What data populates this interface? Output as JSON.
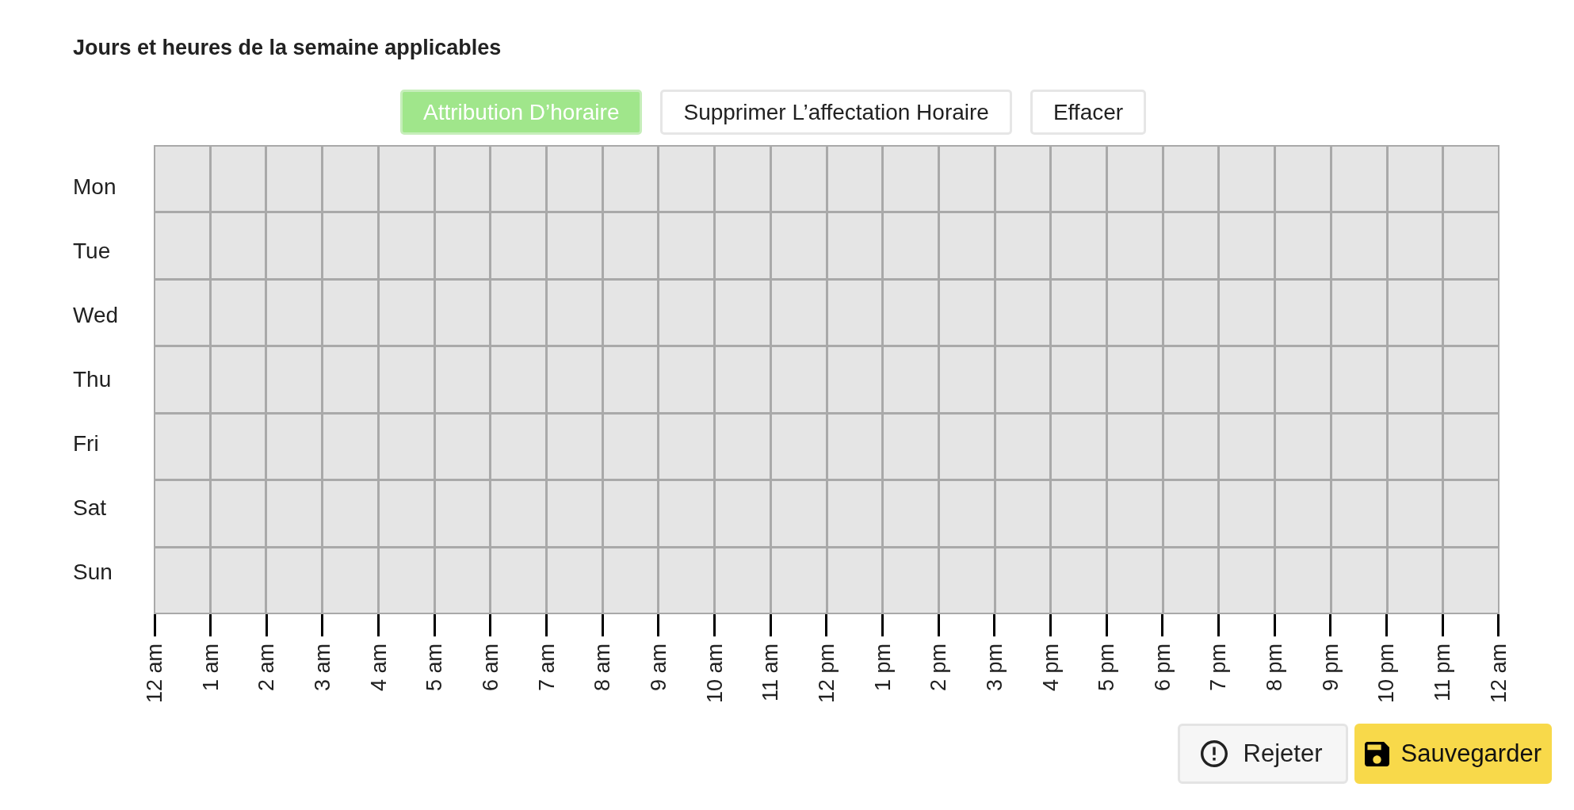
{
  "title": "Jours et heures de la semaine applicables",
  "toolbar": {
    "buttons": [
      {
        "label": "Attribution D’horaire",
        "selected": true
      },
      {
        "label": "Supprimer L’affectation Horaire",
        "selected": false
      },
      {
        "label": "Effacer",
        "selected": false
      }
    ]
  },
  "schedule": {
    "rows": [
      {
        "day": "Mon",
        "cells": [
          {
            "selected": false
          },
          {
            "selected": false
          },
          {
            "selected": false
          },
          {
            "selected": false
          },
          {
            "selected": false
          },
          {
            "selected": false
          },
          {
            "selected": false
          },
          {
            "selected": false
          },
          {
            "selected": false
          },
          {
            "selected": false
          },
          {
            "selected": false
          },
          {
            "selected": false
          },
          {
            "selected": false
          },
          {
            "selected": false
          },
          {
            "selected": false
          },
          {
            "selected": false
          },
          {
            "selected": false
          },
          {
            "selected": false
          },
          {
            "selected": false
          },
          {
            "selected": false
          },
          {
            "selected": false
          },
          {
            "selected": false
          },
          {
            "selected": false
          },
          {
            "selected": false
          }
        ]
      },
      {
        "day": "Tue",
        "cells": [
          {
            "selected": false
          },
          {
            "selected": false
          },
          {
            "selected": false
          },
          {
            "selected": false
          },
          {
            "selected": false
          },
          {
            "selected": false
          },
          {
            "selected": false
          },
          {
            "selected": false
          },
          {
            "selected": false
          },
          {
            "selected": false
          },
          {
            "selected": false
          },
          {
            "selected": false
          },
          {
            "selected": false
          },
          {
            "selected": false
          },
          {
            "selected": false
          },
          {
            "selected": false
          },
          {
            "selected": false
          },
          {
            "selected": false
          },
          {
            "selected": false
          },
          {
            "selected": false
          },
          {
            "selected": false
          },
          {
            "selected": false
          },
          {
            "selected": false
          },
          {
            "selected": false
          }
        ]
      },
      {
        "day": "Wed",
        "cells": [
          {
            "selected": false
          },
          {
            "selected": false
          },
          {
            "selected": false
          },
          {
            "selected": false
          },
          {
            "selected": false
          },
          {
            "selected": false
          },
          {
            "selected": false
          },
          {
            "selected": false
          },
          {
            "selected": false
          },
          {
            "selected": false
          },
          {
            "selected": false
          },
          {
            "selected": false
          },
          {
            "selected": false
          },
          {
            "selected": false
          },
          {
            "selected": false
          },
          {
            "selected": false
          },
          {
            "selected": false
          },
          {
            "selected": false
          },
          {
            "selected": false
          },
          {
            "selected": false
          },
          {
            "selected": false
          },
          {
            "selected": false
          },
          {
            "selected": false
          },
          {
            "selected": false
          }
        ]
      },
      {
        "day": "Thu",
        "cells": [
          {
            "selected": false
          },
          {
            "selected": false
          },
          {
            "selected": false
          },
          {
            "selected": false
          },
          {
            "selected": false
          },
          {
            "selected": false
          },
          {
            "selected": false
          },
          {
            "selected": false
          },
          {
            "selected": false
          },
          {
            "selected": false
          },
          {
            "selected": false
          },
          {
            "selected": false
          },
          {
            "selected": false
          },
          {
            "selected": false
          },
          {
            "selected": false
          },
          {
            "selected": false
          },
          {
            "selected": false
          },
          {
            "selected": false
          },
          {
            "selected": false
          },
          {
            "selected": false
          },
          {
            "selected": false
          },
          {
            "selected": false
          },
          {
            "selected": false
          },
          {
            "selected": false
          }
        ]
      },
      {
        "day": "Fri",
        "cells": [
          {
            "selected": false
          },
          {
            "selected": false
          },
          {
            "selected": false
          },
          {
            "selected": false
          },
          {
            "selected": false
          },
          {
            "selected": false
          },
          {
            "selected": false
          },
          {
            "selected": false
          },
          {
            "selected": false
          },
          {
            "selected": false
          },
          {
            "selected": false
          },
          {
            "selected": false
          },
          {
            "selected": false
          },
          {
            "selected": false
          },
          {
            "selected": false
          },
          {
            "selected": false
          },
          {
            "selected": false
          },
          {
            "selected": false
          },
          {
            "selected": false
          },
          {
            "selected": false
          },
          {
            "selected": false
          },
          {
            "selected": false
          },
          {
            "selected": false
          },
          {
            "selected": false
          }
        ]
      },
      {
        "day": "Sat",
        "cells": [
          {
            "selected": false
          },
          {
            "selected": false
          },
          {
            "selected": false
          },
          {
            "selected": false
          },
          {
            "selected": false
          },
          {
            "selected": false
          },
          {
            "selected": false
          },
          {
            "selected": false
          },
          {
            "selected": false
          },
          {
            "selected": false
          },
          {
            "selected": false
          },
          {
            "selected": false
          },
          {
            "selected": false
          },
          {
            "selected": false
          },
          {
            "selected": false
          },
          {
            "selected": false
          },
          {
            "selected": false
          },
          {
            "selected": false
          },
          {
            "selected": false
          },
          {
            "selected": false
          },
          {
            "selected": false
          },
          {
            "selected": false
          },
          {
            "selected": false
          },
          {
            "selected": false
          }
        ]
      },
      {
        "day": "Sun",
        "cells": [
          {
            "selected": false
          },
          {
            "selected": false
          },
          {
            "selected": false
          },
          {
            "selected": false
          },
          {
            "selected": false
          },
          {
            "selected": false
          },
          {
            "selected": false
          },
          {
            "selected": false
          },
          {
            "selected": false
          },
          {
            "selected": false
          },
          {
            "selected": false
          },
          {
            "selected": false
          },
          {
            "selected": false
          },
          {
            "selected": false
          },
          {
            "selected": false
          },
          {
            "selected": false
          },
          {
            "selected": false
          },
          {
            "selected": false
          },
          {
            "selected": false
          },
          {
            "selected": false
          },
          {
            "selected": false
          },
          {
            "selected": false
          },
          {
            "selected": false
          },
          {
            "selected": false
          }
        ]
      }
    ],
    "hour_labels": [
      "12 am",
      "1 am",
      "2 am",
      "3 am",
      "4 am",
      "5 am",
      "6 am",
      "7 am",
      "8 am",
      "9 am",
      "10 am",
      "11 am",
      "12 pm",
      "1 pm",
      "2 pm",
      "3 pm",
      "4 pm",
      "5 pm",
      "6 pm",
      "7 pm",
      "8 pm",
      "9 pm",
      "10 pm",
      "11 pm",
      "12 am"
    ]
  },
  "footer": {
    "buttons": [
      {
        "kind": "reject",
        "label": "Rejeter"
      },
      {
        "kind": "save",
        "label": "Sauvegarder"
      }
    ]
  }
}
